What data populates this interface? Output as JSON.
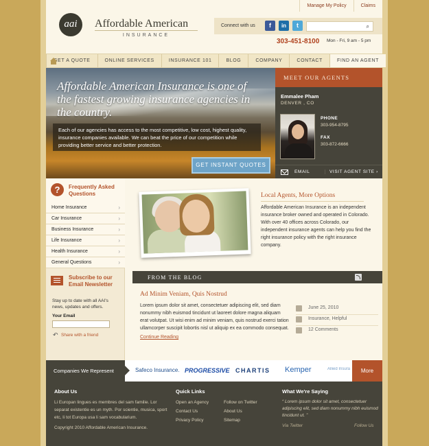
{
  "header": {
    "top_links": [
      "Manage My Policy",
      "Claims"
    ],
    "logo_mark": "aai",
    "logo_title": "Affordable American",
    "logo_subtitle": "INSURANCE",
    "connect_label": "Connect with us",
    "social": [
      {
        "icon": "facebook-icon",
        "glyph": "f",
        "color": "#3b5998"
      },
      {
        "icon": "linkedin-icon",
        "glyph": "in",
        "color": "#1d6ea8"
      },
      {
        "icon": "twitter-icon",
        "glyph": "t",
        "color": "#4fa8d8"
      }
    ],
    "search_icon": "⌕",
    "phone": "303-451-8100",
    "hours": "Mon - Fri, 9 am - 5 pm"
  },
  "nav": {
    "items": [
      "GET A QUOTE",
      "ONLINE SERVICES",
      "INSURANCE 101",
      "BLOG",
      "COMPANY",
      "CONTACT",
      "FIND AN AGENT"
    ]
  },
  "hero": {
    "title": "Affordable American Insurance is one of the fastest growing insurance agencies in the country.",
    "text": "Each of our agencies has access to the most competitive, low cost, highest quality, insurance companies available. We can beat the price of our competition while providing better service and better protection.",
    "button": "GET INSTANT QUOTES"
  },
  "agent": {
    "heading": "MEET OUR AGENTS",
    "name": "Emmalee Pham",
    "location": "DENVER , CO",
    "phone_label": "PHONE",
    "phone": "303-954-8795",
    "fax_label": "FAX",
    "fax": "303-872-6666",
    "email_label": "EMAIL",
    "visit_label": "VISIT AGENT SITE",
    "visit_arrow": "›"
  },
  "sidebar": {
    "faq_icon": "?",
    "faq_title": "Frequently Asked Questions",
    "items": [
      "Home Insurance",
      "Car Insurance",
      "Business Insurance",
      "Life Insurance",
      "Health Insurance",
      "General Questions"
    ],
    "chevron": "›",
    "newsletter_title": "Subscribe to our Email Newsletter",
    "newsletter_text": "Stay up to date with all AAI's news, updates and offers.",
    "email_label": "Your Email",
    "share_icon": "↶",
    "share_text": "Share with a friend"
  },
  "local": {
    "title": "Local Agents, More Options",
    "text": "Affordable American Insurance is an independent insurance broker owned and operated in Colorado. With over 40 offices across Colorado, our independent insurance agents can help you find the right insurance policy with the right insurance company."
  },
  "blog": {
    "heading": "FROM THE BLOG",
    "post_title": "Ad Minim Veniam, Quis Nostrud",
    "post_text": "Lorem ipsum dolor sit amet, consectetuer adipiscing elit, sed diam nonummy nibh euismod tincidunt ut laoreet dolore magna aliquam erat volutpat. Ut wisi enim ad minim veniam, quis nostrud exerci tation ullamcorper suscipit lobortis nisl ut aliquip ex ea commodo consequat.",
    "read_more": "Continue Reading",
    "date": "June 25, 2010",
    "tags": "Insurance, Helpful",
    "comments": "12 Comments"
  },
  "companies": {
    "label": "Companies We Represent",
    "logos": [
      {
        "name": "Safeco Insurance.",
        "color": "#1e4d8c"
      },
      {
        "name": "PROGRESSIVE",
        "color": "#1a4aa5"
      },
      {
        "name": "CHARTIS",
        "color": "#1b3f79"
      },
      {
        "name": "Kemper",
        "color": "#2a66b1"
      },
      {
        "name": "Allied Insura",
        "color": "#7aa0c8"
      }
    ],
    "more": "More"
  },
  "footer": {
    "about_title": "About Us",
    "about_text": "Li Europan lingues es membres del sam familie. Lor separat existentie es un myth. Por scientie, musica, sport etc, li tot Europa usa li sam vocabularium.",
    "copyright": "Copyright 2010 Affordable American Insurance.",
    "quick_title": "Quick Links",
    "quick_links": [
      "Open an Agency",
      "Contact Us",
      "Privacy Policy",
      "Follow on Twitter",
      "About Us",
      "Sitemap"
    ],
    "saying_title": "What We're Saying",
    "quote": "Lorem ipsum dolor sit amet, consectetuer adipiscing elit, sed diam nonummy nibh euismod tincidunt ut.",
    "open_quote": "“",
    "close_quote": "”",
    "via": "Via Twitter",
    "follow": "Follow Us"
  }
}
